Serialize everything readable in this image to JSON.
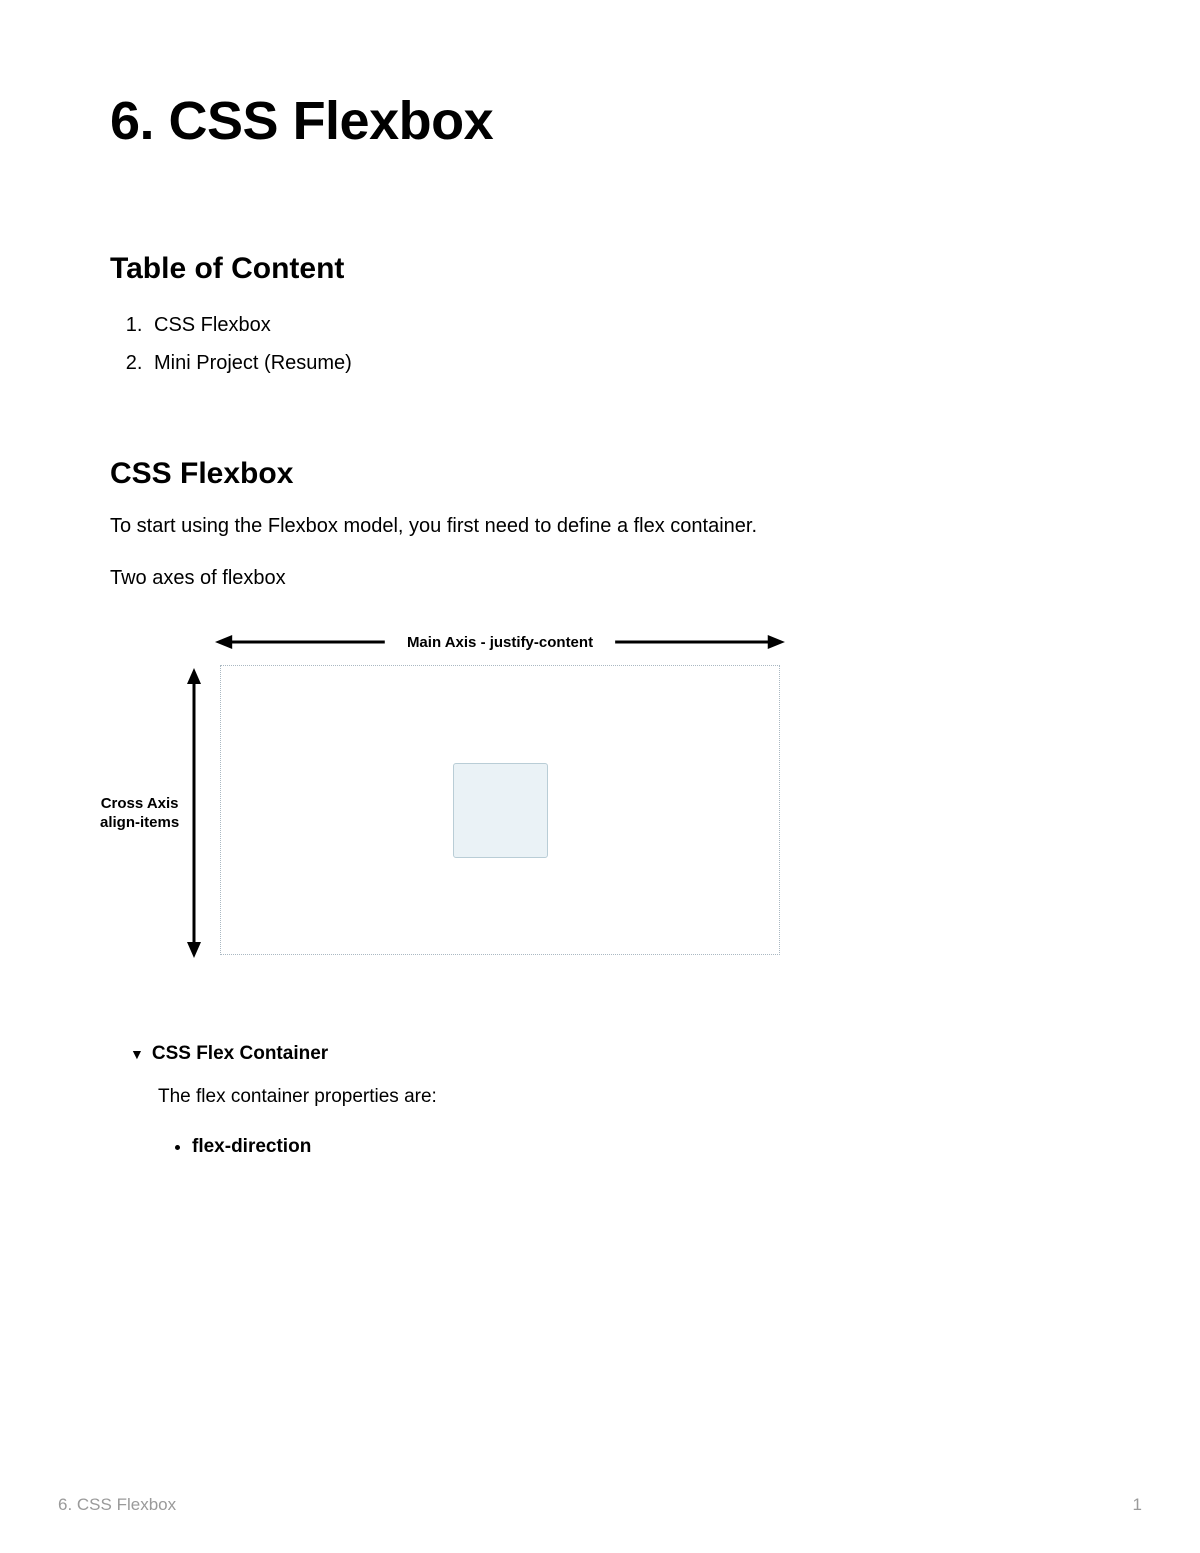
{
  "title": "6. CSS Flexbox",
  "toc": {
    "heading": "Table of Content",
    "items": [
      "CSS Flexbox",
      "Mini Project (Resume)"
    ]
  },
  "section": {
    "heading": "CSS Flexbox",
    "intro": "To start using the Flexbox model, you first need to define a flex container.",
    "subintro": "Two axes of flexbox"
  },
  "diagram": {
    "main_axis_label": "Main Axis - justify-content",
    "cross_axis_label": "Cross Axis\nalign-items"
  },
  "collapsible": {
    "title": "CSS Flex Container",
    "lead": "The flex container properties are:",
    "properties": [
      "flex-direction"
    ]
  },
  "footer": {
    "left": "6. CSS Flexbox",
    "right": "1"
  }
}
